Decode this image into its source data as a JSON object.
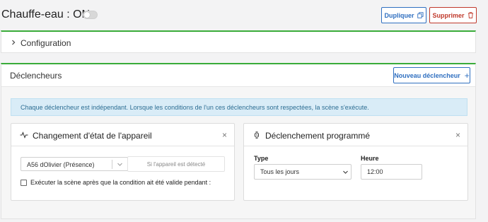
{
  "header": {
    "scene_title": "Chauffe-eau : ON",
    "duplicate_label": "Dupliquer",
    "delete_label": "Supprimer",
    "accent_green": "#3aac3a",
    "primary_blue": "#2f6fc0",
    "danger_red": "#c0392b"
  },
  "config": {
    "label": "Configuration"
  },
  "triggers": {
    "title": "Déclencheurs",
    "new_trigger_label": "Nouveau déclencheur",
    "info_text": "Chaque déclencheur est indépendant. Lorsque les conditions de l'un ces déclencheurs sont respectées, la scène s'exécute.",
    "device_card": {
      "title": "Changement d'état de l'appareil",
      "icon": "activity-icon",
      "close": "×",
      "device_value": "A56 dOlivier (Présence)",
      "detect_label": "Si l'appareil est détecté",
      "exec_label": "Exécuter la scène après que la condition ait été valide pendant :"
    },
    "scheduled_card": {
      "title": "Déclenchement programmé",
      "icon": "watch-icon",
      "close": "×",
      "type_label": "Type",
      "type_value": "Tous les jours",
      "time_label": "Heure",
      "time_value": "12:00"
    }
  }
}
